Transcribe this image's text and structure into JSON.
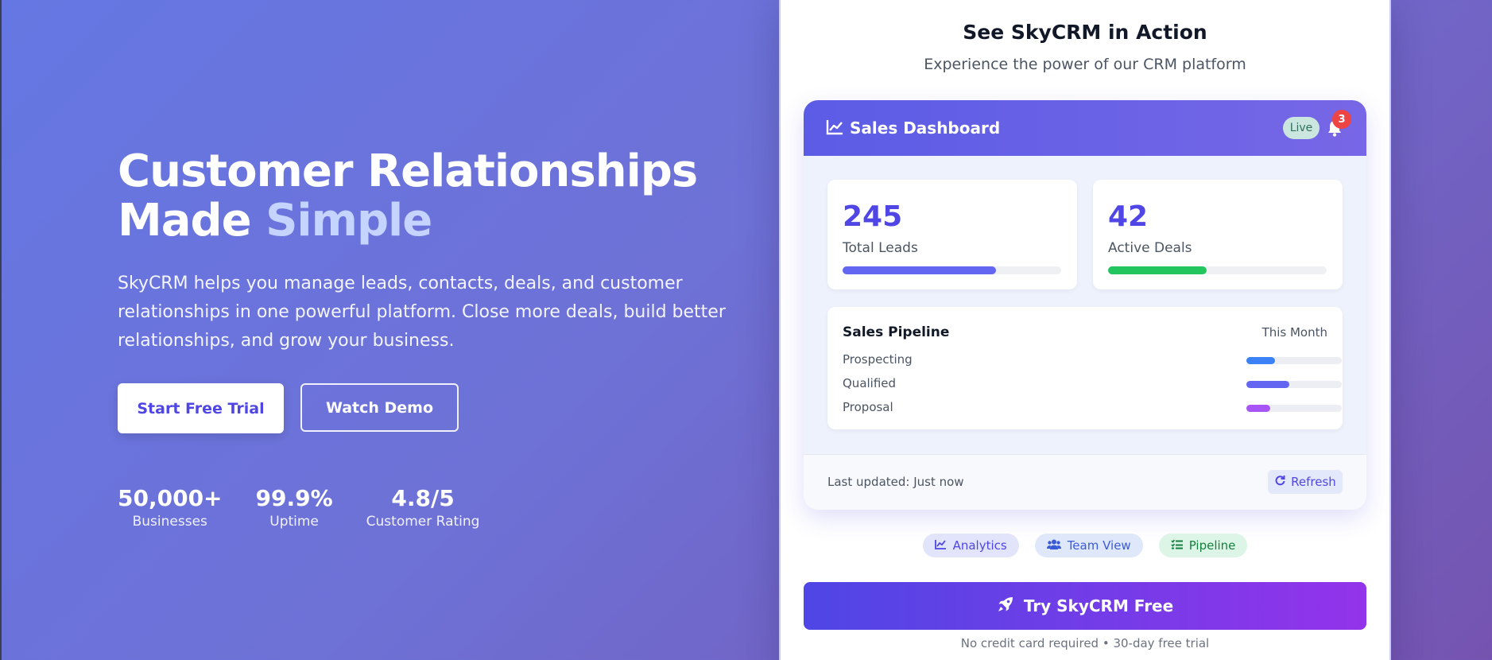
{
  "hero": {
    "title_line1": "Customer Relationships",
    "title_made": "Made ",
    "title_highlight": "Simple",
    "description": "SkyCRM helps you manage leads, contacts, deals, and customer relationships in one powerful platform. Close more deals, build better relationships, and grow your business.",
    "primary_cta": "Start Free Trial",
    "secondary_cta": "Watch Demo",
    "stats": [
      {
        "value": "50,000+",
        "label": "Businesses"
      },
      {
        "value": "99.9%",
        "label": "Uptime"
      },
      {
        "value": "4.8/5",
        "label": "Customer Rating"
      }
    ]
  },
  "demo": {
    "title": "See SkyCRM in Action",
    "subtitle": "Experience the power of our CRM platform",
    "dashboard": {
      "title": "Sales Dashboard",
      "live_label": "Live",
      "notification_count": "3",
      "metrics": [
        {
          "value": "245",
          "label": "Total Leads",
          "progress": 0.7,
          "color": "#6366f1"
        },
        {
          "value": "42",
          "label": "Active Deals",
          "progress": 0.45,
          "color": "#22c55e"
        }
      ],
      "pipeline": {
        "title": "Sales Pipeline",
        "period": "This Month",
        "stages": [
          {
            "name": "Prospecting",
            "progress": 0.3,
            "color": "#3b82f6"
          },
          {
            "name": "Qualified",
            "progress": 0.45,
            "color": "#6366f1"
          },
          {
            "name": "Proposal",
            "progress": 0.25,
            "color": "#a855f7"
          }
        ]
      },
      "last_updated": "Last updated: Just now",
      "refresh_label": "Refresh"
    },
    "chips": [
      {
        "label": "Analytics",
        "icon": "chart-line-icon"
      },
      {
        "label": "Team View",
        "icon": "users-icon"
      },
      {
        "label": "Pipeline",
        "icon": "tasks-icon"
      }
    ],
    "cta": "Try SkyCRM Free",
    "fineprint": "No credit card required • 30-day free trial"
  },
  "colors": {
    "accent": "#4f46e5",
    "background_start": "#6577e3",
    "background_end": "#7554b0"
  }
}
